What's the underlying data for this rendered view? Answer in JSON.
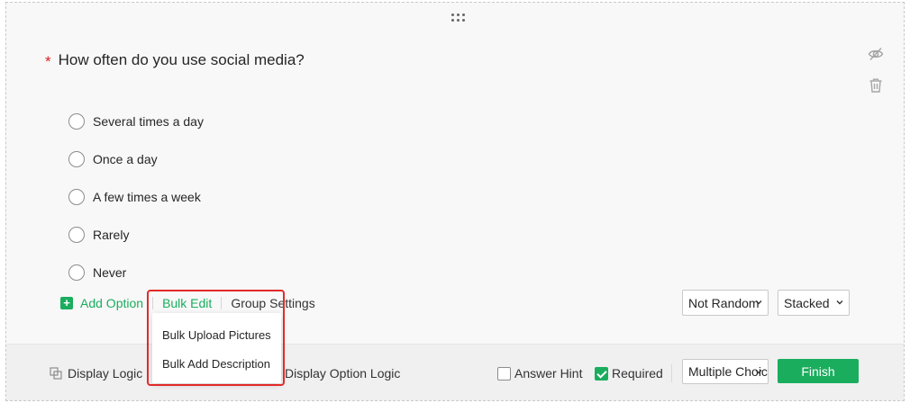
{
  "question": {
    "required_marker": "*",
    "text": "How often do you use social media?",
    "options": [
      {
        "label": "Several times a day"
      },
      {
        "label": "Once a day"
      },
      {
        "label": "A few times a week"
      },
      {
        "label": "Rarely"
      },
      {
        "label": "Never"
      }
    ]
  },
  "editor": {
    "add_option": "Add Option",
    "bulk_edit": "Bulk Edit",
    "group_settings": "Group Settings",
    "randomize_select": "Not Random",
    "layout_select": "Stacked"
  },
  "bulk_menu": {
    "items": [
      {
        "label": "Bulk Upload Pictures"
      },
      {
        "label": "Bulk Add Description"
      }
    ]
  },
  "footer": {
    "display_logic": "Display Logic",
    "display_option_logic": "Display Option Logic",
    "answer_hint": "Answer Hint",
    "answer_hint_checked": false,
    "required": "Required",
    "required_checked": true,
    "question_type": "Multiple Choice",
    "finish": "Finish"
  },
  "icons": {
    "drag": "drag-handle-icon",
    "hide": "eye-off-icon",
    "delete": "trash-icon",
    "add": "plus-icon",
    "display_logic": "logic-copy-icon",
    "chevron": "chevron-down-icon"
  },
  "colors": {
    "accent": "#1aad5e",
    "required": "#e02020",
    "highlight": "#e22a2a"
  }
}
